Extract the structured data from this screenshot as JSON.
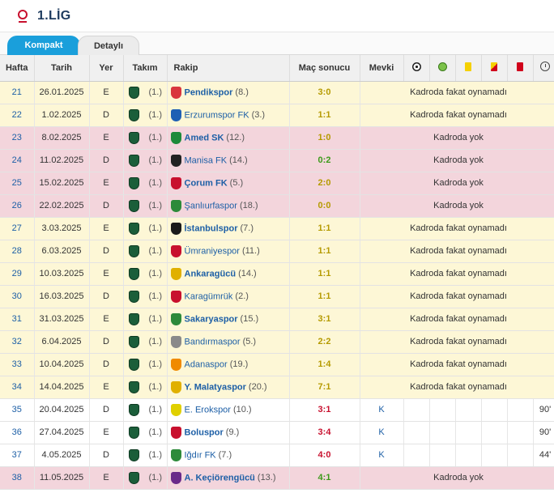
{
  "header": {
    "title": "1.LİG"
  },
  "tabs": [
    {
      "label": "Kompakt"
    },
    {
      "label": "Detaylı"
    }
  ],
  "columns": {
    "hafta": "Hafta",
    "tarih": "Tarih",
    "yer": "Yer",
    "takim": "Takım",
    "rakip": "Rakip",
    "mac_sonucu": "Maç sonucu",
    "mevki": "Mevki"
  },
  "icons": [
    "goal-icon",
    "assist-icon",
    "yellow-card-icon",
    "yellow-red-card-icon",
    "red-card-icon",
    "minutes-icon"
  ],
  "rows": [
    {
      "week": "21",
      "date": "26.01.2025",
      "venue": "E",
      "team_rank": "(1.)",
      "opponent": "Pendikspor",
      "opp_rank": "(8.)",
      "result": "3:0",
      "result_type": "draw",
      "bold": true,
      "row_type": "notplayed",
      "status": "Kadroda fakat oynamadı",
      "crest_color": "#d9363e"
    },
    {
      "week": "22",
      "date": "1.02.2025",
      "venue": "D",
      "team_rank": "(1.)",
      "opponent": "Erzurumspor FK",
      "opp_rank": "(3.)",
      "result": "1:1",
      "result_type": "draw",
      "bold": false,
      "row_type": "notplayed",
      "status": "Kadroda fakat oynamadı",
      "crest_color": "#1e5fb4"
    },
    {
      "week": "23",
      "date": "8.02.2025",
      "venue": "E",
      "team_rank": "(1.)",
      "opponent": "Amed SK",
      "opp_rank": "(12.)",
      "result": "1:0",
      "result_type": "draw",
      "bold": true,
      "row_type": "absent",
      "status": "Kadroda yok",
      "crest_color": "#1d8a3a"
    },
    {
      "week": "24",
      "date": "11.02.2025",
      "venue": "D",
      "team_rank": "(1.)",
      "opponent": "Manisa FK",
      "opp_rank": "(14.)",
      "result": "0:2",
      "result_type": "win",
      "bold": false,
      "row_type": "absent",
      "status": "Kadroda yok",
      "crest_color": "#222222"
    },
    {
      "week": "25",
      "date": "15.02.2025",
      "venue": "E",
      "team_rank": "(1.)",
      "opponent": "Çorum FK",
      "opp_rank": "(5.)",
      "result": "2:0",
      "result_type": "draw",
      "bold": true,
      "row_type": "absent",
      "status": "Kadroda yok",
      "crest_color": "#c8102e"
    },
    {
      "week": "26",
      "date": "22.02.2025",
      "venue": "D",
      "team_rank": "(1.)",
      "opponent": "Şanlıurfaspor",
      "opp_rank": "(18.)",
      "result": "0:0",
      "result_type": "draw",
      "bold": false,
      "row_type": "absent",
      "status": "Kadroda yok",
      "crest_color": "#2d8a3a"
    },
    {
      "week": "27",
      "date": "3.03.2025",
      "venue": "E",
      "team_rank": "(1.)",
      "opponent": "İstanbulspor",
      "opp_rank": "(7.)",
      "result": "1:1",
      "result_type": "draw",
      "bold": true,
      "row_type": "notplayed",
      "status": "Kadroda fakat oynamadı",
      "crest_color": "#1a1a1a"
    },
    {
      "week": "28",
      "date": "6.03.2025",
      "venue": "D",
      "team_rank": "(1.)",
      "opponent": "Ümraniyespor",
      "opp_rank": "(11.)",
      "result": "1:1",
      "result_type": "draw",
      "bold": false,
      "row_type": "notplayed",
      "status": "Kadroda fakat oynamadı",
      "crest_color": "#c8102e"
    },
    {
      "week": "29",
      "date": "10.03.2025",
      "venue": "E",
      "team_rank": "(1.)",
      "opponent": "Ankaragücü",
      "opp_rank": "(14.)",
      "result": "1:1",
      "result_type": "draw",
      "bold": true,
      "row_type": "notplayed",
      "status": "Kadroda fakat oynamadı",
      "crest_color": "#e0b000"
    },
    {
      "week": "30",
      "date": "16.03.2025",
      "venue": "D",
      "team_rank": "(1.)",
      "opponent": "Karagümrük",
      "opp_rank": "(2.)",
      "result": "1:1",
      "result_type": "draw",
      "bold": false,
      "row_type": "notplayed",
      "status": "Kadroda fakat oynamadı",
      "crest_color": "#c8102e"
    },
    {
      "week": "31",
      "date": "31.03.2025",
      "venue": "E",
      "team_rank": "(1.)",
      "opponent": "Sakaryaspor",
      "opp_rank": "(15.)",
      "result": "3:1",
      "result_type": "draw",
      "bold": true,
      "row_type": "notplayed",
      "status": "Kadroda fakat oynamadı",
      "crest_color": "#2d8a3a"
    },
    {
      "week": "32",
      "date": "6.04.2025",
      "venue": "D",
      "team_rank": "(1.)",
      "opponent": "Bandırmaspor",
      "opp_rank": "(5.)",
      "result": "2:2",
      "result_type": "draw",
      "bold": false,
      "row_type": "notplayed",
      "status": "Kadroda fakat oynamadı",
      "crest_color": "#8a8a8a"
    },
    {
      "week": "33",
      "date": "10.04.2025",
      "venue": "D",
      "team_rank": "(1.)",
      "opponent": "Adanaspor",
      "opp_rank": "(19.)",
      "result": "1:4",
      "result_type": "draw",
      "bold": false,
      "row_type": "notplayed",
      "status": "Kadroda fakat oynamadı",
      "crest_color": "#f08a00"
    },
    {
      "week": "34",
      "date": "14.04.2025",
      "venue": "E",
      "team_rank": "(1.)",
      "opponent": "Y. Malatyaspor",
      "opp_rank": "(20.)",
      "result": "7:1",
      "result_type": "draw",
      "bold": true,
      "row_type": "notplayed",
      "status": "Kadroda fakat oynamadı",
      "crest_color": "#e0b000"
    },
    {
      "week": "35",
      "date": "20.04.2025",
      "venue": "D",
      "team_rank": "(1.)",
      "opponent": "E. Erokspor",
      "opp_rank": "(10.)",
      "result": "3:1",
      "result_type": "loss",
      "bold": false,
      "row_type": "played",
      "position": "K",
      "minutes": "90'",
      "crest_color": "#e0d000"
    },
    {
      "week": "36",
      "date": "27.04.2025",
      "venue": "E",
      "team_rank": "(1.)",
      "opponent": "Boluspor",
      "opp_rank": "(9.)",
      "result": "3:4",
      "result_type": "loss",
      "bold": true,
      "row_type": "played",
      "position": "K",
      "minutes": "90'",
      "crest_color": "#c8102e"
    },
    {
      "week": "37",
      "date": "4.05.2025",
      "venue": "D",
      "team_rank": "(1.)",
      "opponent": "Iğdır FK",
      "opp_rank": "(7.)",
      "result": "4:0",
      "result_type": "loss",
      "bold": false,
      "row_type": "played",
      "position": "K",
      "minutes": "44'",
      "crest_color": "#2d8a3a"
    },
    {
      "week": "38",
      "date": "11.05.2025",
      "venue": "E",
      "team_rank": "(1.)",
      "opponent": "A. Keçiörengücü",
      "opp_rank": "(13.)",
      "result": "4:1",
      "result_type": "win",
      "bold": true,
      "row_type": "absent",
      "status": "Kadroda yok",
      "crest_color": "#6a2a8a"
    }
  ]
}
